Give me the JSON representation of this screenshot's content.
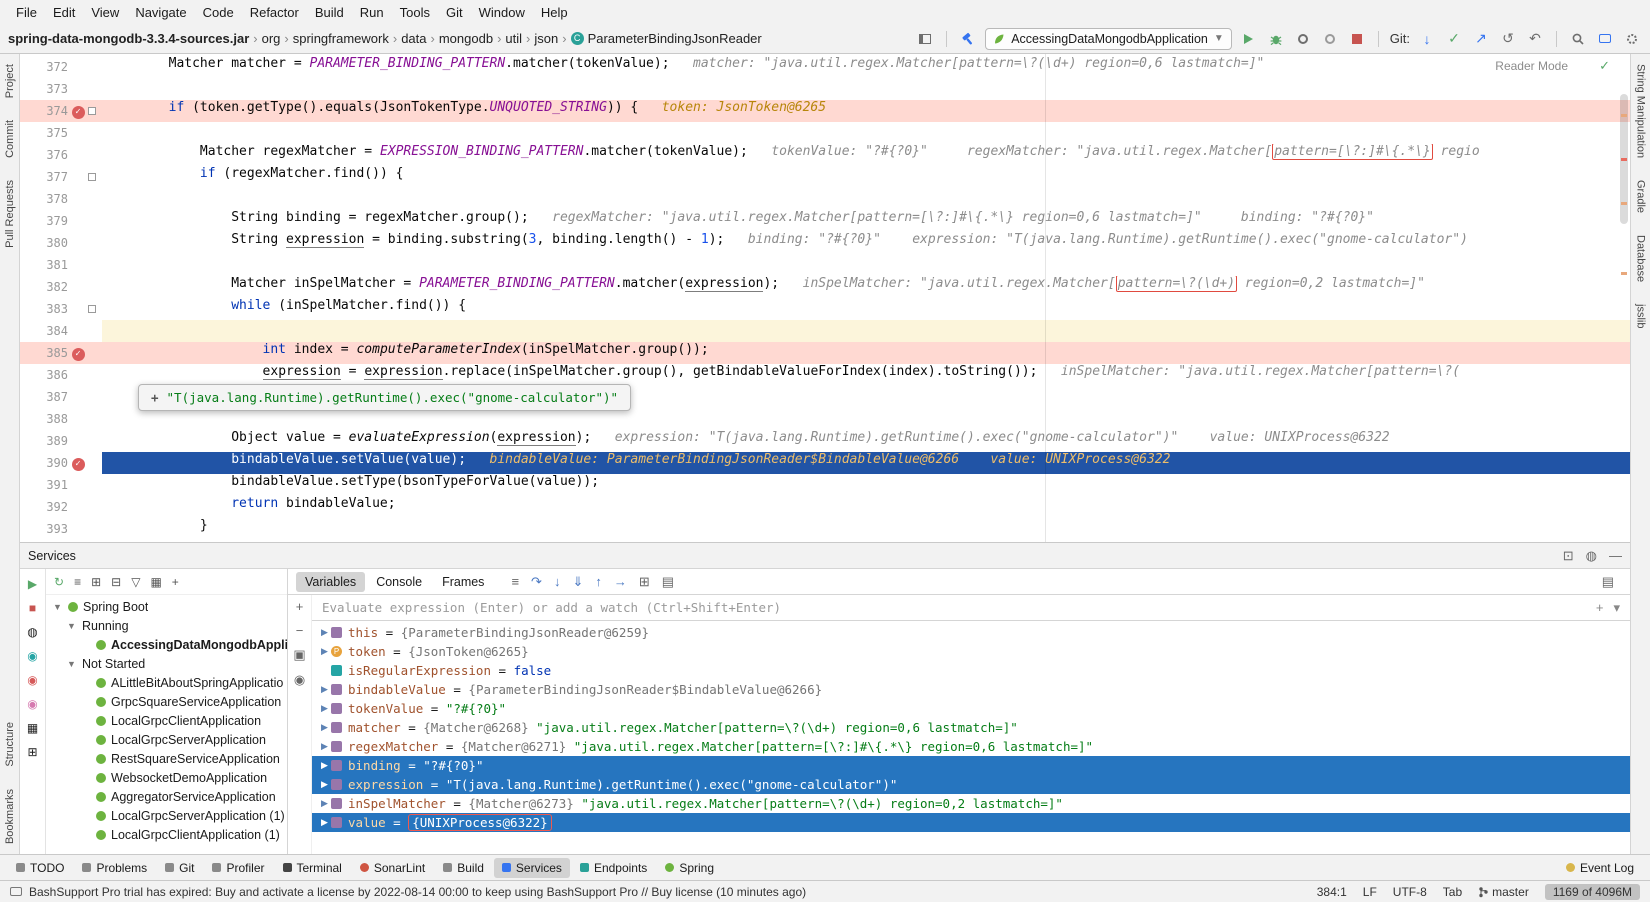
{
  "colors": {
    "execution_line": "#2154a6",
    "selection": "#2675bf",
    "breakpoint_line": "#ffd9d2",
    "breakpoint_dot": "#db5c5c",
    "spring_green": "#6db33f",
    "annotation_red": "#e04a3f"
  },
  "menu": [
    "File",
    "Edit",
    "View",
    "Navigate",
    "Code",
    "Refactor",
    "Build",
    "Run",
    "Tools",
    "Git",
    "Window",
    "Help"
  ],
  "breadcrumbs": [
    "spring-data-mongodb-3.3.4-sources.jar",
    "org",
    "springframework",
    "data",
    "mongodb",
    "util",
    "json",
    "ParameterBindingJsonReader"
  ],
  "toolbar": {
    "run_config": "AccessingDataMongodbApplication",
    "git_label": "Git:"
  },
  "left_stripe": [
    "Project",
    "Commit",
    "Pull Requests"
  ],
  "left_stripe_bottom": [
    "Structure",
    "Bookmarks"
  ],
  "right_stripe": [
    "String Manipulation",
    "Gradle",
    "Database",
    "jsslib"
  ],
  "editor": {
    "reader_mode": "Reader Mode",
    "tooltip_plus": "+",
    "tooltip": "\"T(java.lang.Runtime).getRuntime().exec(\"gnome-calculator\")\"",
    "lines": [
      {
        "n": 372,
        "seg": [
          [
            "p",
            "        Matcher matcher = "
          ],
          [
            "c",
            "PARAMETER_BINDING_PATTERN"
          ],
          [
            "p",
            ".matcher(tokenValue);"
          ],
          [
            "h",
            "   matcher: \"java.util.regex.Matcher[pattern=\\?(\\d+) region=0,6 lastmatch=]\""
          ]
        ]
      },
      {
        "n": 373,
        "seg": []
      },
      {
        "n": 374,
        "cls": "bp",
        "bp": true,
        "fold": true,
        "seg": [
          [
            "k",
            "        if"
          ],
          [
            "p",
            " (token.getType().equals(JsonTokenType."
          ],
          [
            "c",
            "UNQUOTED_STRING"
          ],
          [
            "p",
            ")) {"
          ],
          [
            "hg",
            "   token: JsonToken@6265"
          ]
        ]
      },
      {
        "n": 375,
        "seg": []
      },
      {
        "n": 376,
        "seg": [
          [
            "p",
            "            Matcher regexMatcher = "
          ],
          [
            "c",
            "EXPRESSION_BINDING_PATTERN"
          ],
          [
            "p",
            ".matcher(tokenValue);"
          ],
          [
            "h",
            "   tokenValue: \"?#{?0}\"     regexMatcher: \"java.util.regex.Matcher["
          ],
          [
            "hb",
            "pattern=[\\?:]#\\{.*\\}"
          ],
          [
            "h",
            " regio"
          ]
        ]
      },
      {
        "n": 377,
        "fold": true,
        "seg": [
          [
            "k",
            "            if"
          ],
          [
            "p",
            " (regexMatcher.find()) {"
          ]
        ]
      },
      {
        "n": 378,
        "seg": []
      },
      {
        "n": 379,
        "seg": [
          [
            "p",
            "                String binding = regexMatcher.group();"
          ],
          [
            "h",
            "   regexMatcher: \"java.util.regex.Matcher[pattern=[\\?:]#\\{.*\\} region=0,6 lastmatch=]\"     binding: \"?#{?0}\""
          ]
        ]
      },
      {
        "n": 380,
        "seg": [
          [
            "p",
            "                String "
          ],
          [
            "u",
            "expression"
          ],
          [
            "p",
            " = binding.substring("
          ],
          [
            "nm",
            "3"
          ],
          [
            "p",
            ", binding.length() - "
          ],
          [
            "nm",
            "1"
          ],
          [
            "p",
            ");"
          ],
          [
            "h",
            "   binding: \"?#{?0}\"    expression: \"T(java.lang.Runtime).getRuntime().exec(\"gnome-calculator\")"
          ]
        ]
      },
      {
        "n": 381,
        "seg": []
      },
      {
        "n": 382,
        "seg": [
          [
            "p",
            "                Matcher inSpelMatcher = "
          ],
          [
            "c",
            "PARAMETER_BINDING_PATTERN"
          ],
          [
            "p",
            ".matcher("
          ],
          [
            "u",
            "expression"
          ],
          [
            "p",
            ");"
          ],
          [
            "h",
            "   inSpelMatcher: \"java.util.regex.Matcher["
          ],
          [
            "hb",
            "pattern=\\?(\\d+)"
          ],
          [
            "h",
            " region=0,2 lastmatch=]\""
          ]
        ]
      },
      {
        "n": 383,
        "fold": true,
        "seg": [
          [
            "k",
            "                while"
          ],
          [
            "p",
            " (inSpelMatcher.find()) {"
          ]
        ]
      },
      {
        "n": 384,
        "cls": "caret",
        "seg": []
      },
      {
        "n": 385,
        "cls": "bp",
        "bp": true,
        "seg": [
          [
            "k",
            "                    int"
          ],
          [
            "p",
            " index = "
          ],
          [
            "m",
            "computeParameterIndex"
          ],
          [
            "p",
            "(inSpelMatcher.group());"
          ]
        ]
      },
      {
        "n": 386,
        "seg": [
          [
            "p",
            "                    "
          ],
          [
            "u",
            "expression"
          ],
          [
            "p",
            " = "
          ],
          [
            "u",
            "expression"
          ],
          [
            "p",
            ".replace(inSpelMatcher.group(), getBindableValueForIndex(index).toString());"
          ],
          [
            "h",
            "   inSpelMatcher: \"java.util.regex.Matcher[pattern=\\?("
          ]
        ]
      },
      {
        "n": 387,
        "seg": [
          [
            "p",
            "                }"
          ]
        ]
      },
      {
        "n": 388,
        "seg": []
      },
      {
        "n": 389,
        "seg": [
          [
            "p",
            "                Object value = "
          ],
          [
            "m",
            "evaluateExpression"
          ],
          [
            "p",
            "("
          ],
          [
            "u",
            "expression"
          ],
          [
            "p",
            ");"
          ],
          [
            "h",
            "   expression: \"T(java.lang.Runtime).getRuntime().exec(\"gnome-calculator\")\"    value: UNIXProcess@6322"
          ]
        ]
      },
      {
        "n": 390,
        "cls": "exec",
        "bp": true,
        "seg": [
          [
            "w",
            "                bindableValue.setValue(value);"
          ],
          [
            "wh",
            "   bindableValue: ParameterBindingJsonReader$BindableValue@6266    value: UNIXProcess@6322"
          ]
        ]
      },
      {
        "n": 391,
        "seg": [
          [
            "p",
            "                bindableValue.setType(bsonTypeForValue(value));"
          ]
        ]
      },
      {
        "n": 392,
        "seg": [
          [
            "k",
            "                return"
          ],
          [
            "p",
            " bindableValue;"
          ]
        ]
      },
      {
        "n": 393,
        "seg": [
          [
            "p",
            "            }"
          ]
        ]
      }
    ]
  },
  "services": {
    "title": "Services",
    "header_icons": [
      {
        "n": "float-window-icon",
        "g": "⊡"
      },
      {
        "n": "settings-gear-icon",
        "g": "◍"
      },
      {
        "n": "hide-icon",
        "g": "—"
      }
    ],
    "toolbar_icons": [
      {
        "n": "refresh-icon",
        "g": "↻",
        "c": "#59a869"
      },
      {
        "n": "view-options-icon",
        "g": "≡"
      },
      {
        "n": "expand-all-icon",
        "g": "⊞"
      },
      {
        "n": "collapse-all-icon",
        "g": "⊟"
      },
      {
        "n": "filter-icon",
        "g": "▽"
      },
      {
        "n": "group-by-icon",
        "g": "▦"
      },
      {
        "n": "add-service-icon",
        "g": "+"
      }
    ],
    "side_icons": [
      {
        "n": "run-icon",
        "g": "▶",
        "c": "#59a869"
      },
      {
        "n": "stop-icon",
        "g": "■",
        "c": "#c75450"
      },
      {
        "n": "edit-configuration-icon",
        "g": "◍"
      },
      {
        "n": "health-indicator-icon",
        "g": "◉",
        "c": "#25a5a5"
      },
      {
        "n": "endpoints-icon",
        "g": "◉",
        "c": "#d65a5a"
      },
      {
        "n": "beans-icon",
        "g": "◉",
        "c": "#d67ab0"
      },
      {
        "n": "grid-view-icon",
        "g": "▦"
      },
      {
        "n": "add-tab-icon",
        "g": "⊞"
      }
    ],
    "tree": [
      {
        "label": "Spring Boot",
        "icon": "spring",
        "chev": "▼",
        "indent": 0
      },
      {
        "label": "Running",
        "chev": "▼",
        "indent": 1
      },
      {
        "label": "AccessingDataMongodbApplic",
        "icon": "app",
        "indent": 2,
        "bold": true
      },
      {
        "label": "Not Started",
        "chev": "▼",
        "indent": 1
      },
      {
        "label": "ALittleBitAboutSpringApplicatio",
        "icon": "app",
        "indent": 2
      },
      {
        "label": "GrpcSquareServiceApplication",
        "icon": "app",
        "indent": 2
      },
      {
        "label": "LocalGrpcClientApplication",
        "icon": "app",
        "indent": 2
      },
      {
        "label": "LocalGrpcServerApplication",
        "icon": "app",
        "indent": 2
      },
      {
        "label": "RestSquareServiceApplication",
        "icon": "app",
        "indent": 2
      },
      {
        "label": "WebsocketDemoApplication",
        "icon": "app",
        "indent": 2
      },
      {
        "label": "AggregatorServiceApplication",
        "icon": "app",
        "indent": 2
      },
      {
        "label": "LocalGrpcServerApplication (1)",
        "icon": "app",
        "indent": 2
      },
      {
        "label": "LocalGrpcClientApplication (1)",
        "icon": "app",
        "indent": 2
      }
    ]
  },
  "debugger": {
    "tabs": [
      "Variables",
      "Console",
      "Frames"
    ],
    "active_tab": "Variables",
    "toolbar_icons": [
      {
        "n": "threads-view-icon",
        "g": "≡",
        "gray": true
      },
      {
        "n": "step-over-icon",
        "g": "↷"
      },
      {
        "n": "step-into-icon",
        "g": "↓"
      },
      {
        "n": "force-step-into-icon",
        "g": "⇓"
      },
      {
        "n": "step-out-icon",
        "g": "↑"
      },
      {
        "n": "run-to-cursor-icon",
        "g": "→"
      },
      {
        "n": "evaluate-expression-icon",
        "g": "⊞",
        "gray": true
      },
      {
        "n": "view-options-icon",
        "g": "▤",
        "gray": true
      }
    ],
    "watchbar_icons": [
      {
        "n": "add-watch-icon",
        "g": "+"
      },
      {
        "n": "remove-watch-icon",
        "g": "−"
      },
      {
        "n": "copy-icon",
        "g": "▣"
      },
      {
        "n": "show-watches-icon",
        "g": "◉"
      }
    ],
    "evaluate_placeholder": "Evaluate expression (Enter) or add a watch (Ctrl+Shift+Enter)",
    "eval_icons": [
      {
        "n": "new-watch-icon",
        "g": "+"
      },
      {
        "n": "expand-editor-icon",
        "g": "▾"
      }
    ],
    "variables": [
      {
        "sel": false,
        "chev": true,
        "icon": "obj",
        "segs": [
          [
            "name",
            "this"
          ],
          [
            "eq",
            " = "
          ],
          [
            "ref",
            "{ParameterBindingJsonReader@6259}"
          ]
        ]
      },
      {
        "sel": false,
        "chev": true,
        "icon": "param",
        "segs": [
          [
            "name",
            "token"
          ],
          [
            "eq",
            " = "
          ],
          [
            "ref",
            "{JsonToken@6265}"
          ]
        ]
      },
      {
        "sel": false,
        "chev": false,
        "icon": "prim",
        "segs": [
          [
            "name",
            "isRegularExpression"
          ],
          [
            "eq",
            " = "
          ],
          [
            "kw",
            "false"
          ]
        ]
      },
      {
        "sel": false,
        "chev": true,
        "icon": "obj",
        "segs": [
          [
            "name",
            "bindableValue"
          ],
          [
            "eq",
            " = "
          ],
          [
            "ref",
            "{ParameterBindingJsonReader$BindableValue@6266}"
          ]
        ]
      },
      {
        "sel": false,
        "chev": true,
        "icon": "obj",
        "segs": [
          [
            "name",
            "tokenValue"
          ],
          [
            "eq",
            " = "
          ],
          [
            "str",
            "\"?#{?0}\""
          ]
        ]
      },
      {
        "sel": false,
        "chev": true,
        "icon": "obj",
        "segs": [
          [
            "name",
            "matcher"
          ],
          [
            "eq",
            " = "
          ],
          [
            "ref",
            "{Matcher@6268} "
          ],
          [
            "str",
            "\"java.util.regex.Matcher[pattern=\\?(\\d+) region=0,6 lastmatch=]\""
          ]
        ]
      },
      {
        "sel": false,
        "chev": true,
        "icon": "obj",
        "segs": [
          [
            "name",
            "regexMatcher"
          ],
          [
            "eq",
            " = "
          ],
          [
            "ref",
            "{Matcher@6271} "
          ],
          [
            "str",
            "\"java.util.regex.Matcher[pattern=[\\?:]#\\{.*\\} region=0,6 lastmatch=]\""
          ]
        ]
      },
      {
        "sel": true,
        "chev": true,
        "icon": "obj",
        "segs": [
          [
            "name",
            "binding"
          ],
          [
            "eq",
            " = "
          ],
          [
            "str",
            "\"?#{?0}\""
          ]
        ]
      },
      {
        "sel": true,
        "chev": true,
        "icon": "obj",
        "segs": [
          [
            "name",
            "expression"
          ],
          [
            "eq",
            " = "
          ],
          [
            "str",
            "\"T(java.lang.Runtime).getRuntime().exec(\"gnome-calculator\")\""
          ]
        ]
      },
      {
        "sel": false,
        "chev": true,
        "icon": "obj",
        "segs": [
          [
            "name",
            "inSpelMatcher"
          ],
          [
            "eq",
            " = "
          ],
          [
            "ref",
            "{Matcher@6273} "
          ],
          [
            "str",
            "\"java.util.regex.Matcher[pattern=\\?(\\d+) region=0,2 lastmatch=]\""
          ]
        ]
      },
      {
        "sel": true,
        "chev": true,
        "icon": "obj",
        "segs": [
          [
            "name",
            "value"
          ],
          [
            "eq",
            " = "
          ],
          [
            "refbox",
            "{UNIXProcess@6322}"
          ]
        ]
      }
    ]
  },
  "toolwindow_bar": {
    "left": [
      {
        "label": "TODO",
        "icon": "todo"
      },
      {
        "label": "Problems",
        "icon": "problems"
      },
      {
        "label": "Git",
        "icon": "git"
      },
      {
        "label": "Profiler",
        "icon": "profiler"
      },
      {
        "label": "Terminal",
        "icon": "terminal"
      },
      {
        "label": "SonarLint",
        "icon": "sonarlint"
      },
      {
        "label": "Build",
        "icon": "build"
      },
      {
        "label": "Services",
        "icon": "services",
        "active": true
      },
      {
        "label": "Endpoints",
        "icon": "endpoints"
      },
      {
        "label": "Spring",
        "icon": "spring"
      }
    ],
    "right": [
      {
        "label": "Event Log",
        "icon": "eventlog"
      }
    ]
  },
  "status_bar": {
    "message": "BashSupport Pro trial has expired: Buy and activate a license by 2022-08-14 00:00 to keep using BashSupport Pro // Buy license (10 minutes ago)",
    "items": [
      {
        "label": "384:1",
        "name": "caret-position"
      },
      {
        "label": "LF",
        "name": "line-separator"
      },
      {
        "label": "UTF-8",
        "name": "file-encoding"
      },
      {
        "label": "Tab",
        "name": "indent-style"
      },
      {
        "label": "master",
        "name": "git-branch",
        "branch": true
      },
      {
        "label": "1169 of 4096M",
        "name": "memory-indicator",
        "pill": true
      }
    ]
  }
}
